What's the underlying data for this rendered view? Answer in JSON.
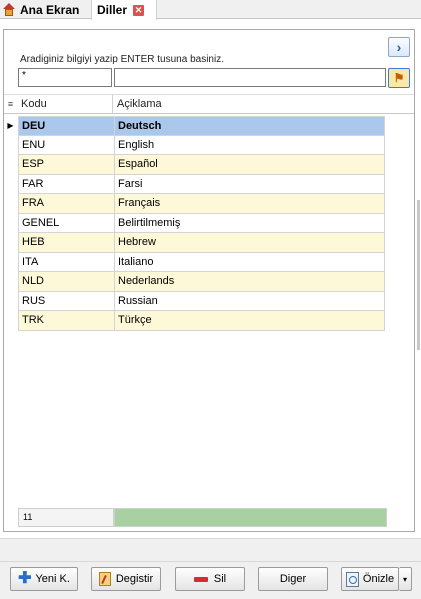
{
  "tabs": {
    "home_label": "Ana Ekran",
    "active_label": "Diller",
    "close_glyph": "✕"
  },
  "search": {
    "hint": "Aradiginiz bilgiyi yazip ENTER tusuna basiniz.",
    "code_value": "*",
    "desc_value": ""
  },
  "grid": {
    "indicator_icon": "≡",
    "columns": [
      "Kodu",
      "Açiklama"
    ],
    "rows": [
      {
        "code": "DEU",
        "desc": "Deutsch"
      },
      {
        "code": "ENU",
        "desc": "English"
      },
      {
        "code": "ESP",
        "desc": "Español"
      },
      {
        "code": "FAR",
        "desc": "Farsi"
      },
      {
        "code": "FRA",
        "desc": "Français"
      },
      {
        "code": "GENEL",
        "desc": "Belirtilmemiş"
      },
      {
        "code": "HEB",
        "desc": "Hebrew"
      },
      {
        "code": "ITA",
        "desc": "Italiano"
      },
      {
        "code": "NLD",
        "desc": "Nederlands"
      },
      {
        "code": "RUS",
        "desc": "Russian"
      },
      {
        "code": "TRK",
        "desc": "Türkçe"
      }
    ],
    "selected_index": 0,
    "selected_marker": "▶",
    "record_count": "11"
  },
  "toolbar": {
    "new_label": "Yeni K.",
    "edit_label": "Degistir",
    "delete_label": "Sil",
    "other_label": "Diger",
    "preview_label": "Önizle",
    "dropdown_glyph": "▾",
    "plus_glyph": "✚",
    "nav_glyph": "›",
    "filter_glyph": "⚑"
  },
  "colors": {
    "selected_row": "#a9c8ec",
    "alt_row": "#fdf8d8",
    "footer_bar": "#a8d0a0"
  }
}
